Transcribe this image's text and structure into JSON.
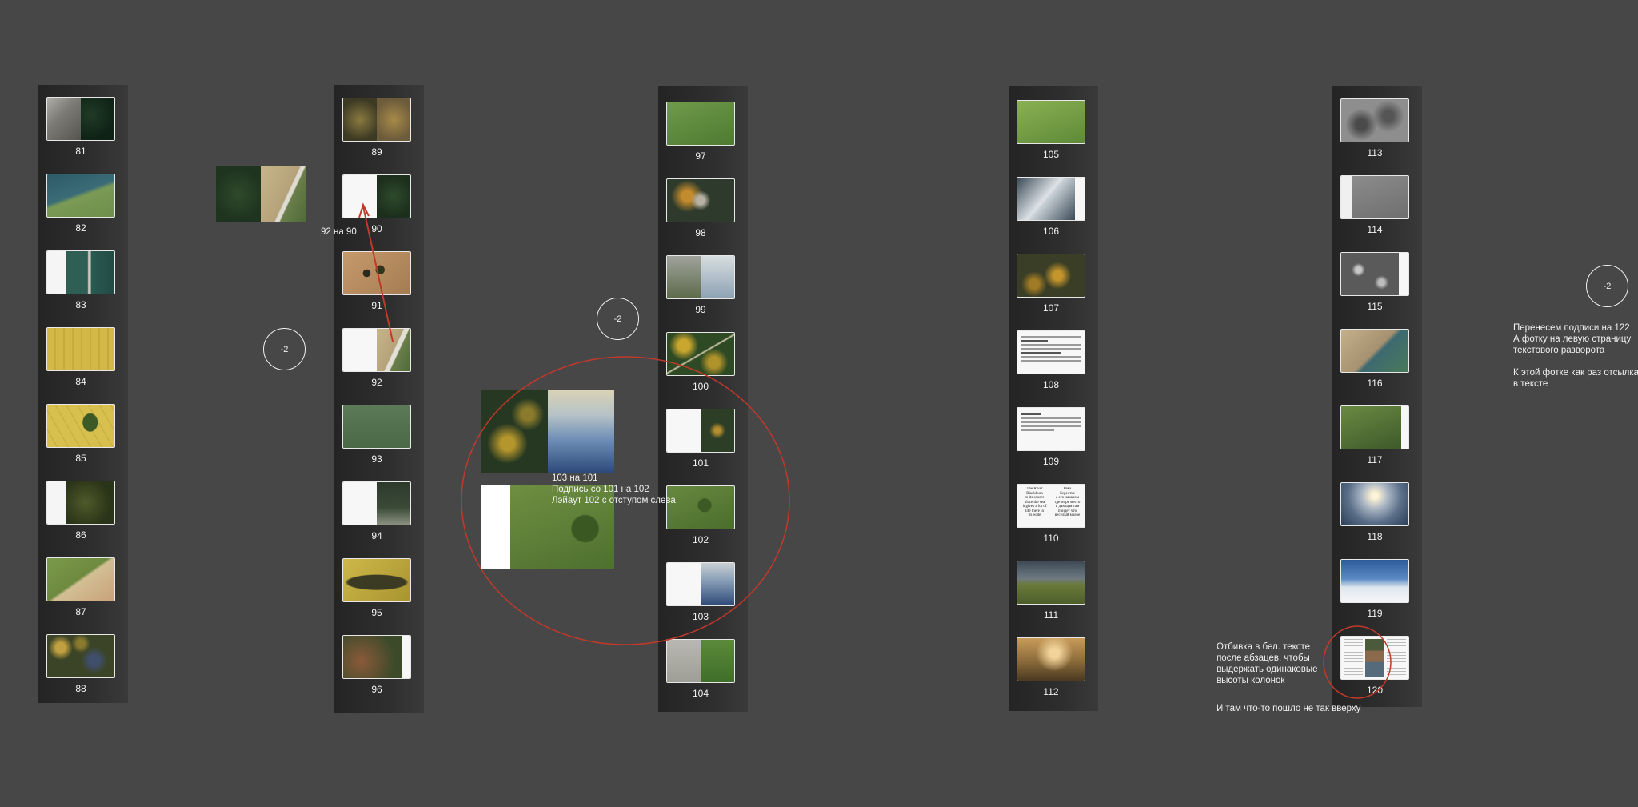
{
  "columns": [
    {
      "pages": [
        "81",
        "82",
        "83",
        "84",
        "85",
        "86",
        "87",
        "88"
      ]
    },
    {
      "pages": [
        "89",
        "90",
        "91",
        "92",
        "93",
        "94",
        "95",
        "96"
      ]
    },
    {
      "pages": [
        "97",
        "98",
        "99",
        "100",
        "101",
        "102",
        "103",
        "104"
      ]
    },
    {
      "pages": [
        "105",
        "106",
        "107",
        "108",
        "109",
        "110",
        "111",
        "112"
      ]
    },
    {
      "pages": [
        "113",
        "114",
        "115",
        "116",
        "117",
        "118",
        "119",
        "120"
      ]
    }
  ],
  "badges": {
    "b1": "-2",
    "b2": "-2",
    "b3": "-2"
  },
  "notes": {
    "n92on90": "92 на 90",
    "n103": "103 на 101\nПодпись со 101 на 102\nЛэйаут 102 с отступом слева",
    "n_right": "Перенесем подписи на 122\nА фотку на левую страницу\nтекстового разворота\n\nК этой фотке как раз отсылка\nв тексте",
    "n_bottom": "Отбивка в бел. тексте\nпосле абзацев, чтобы\nвыдержать одинаковые\nвысоты колонок",
    "n_bottom2": "И там что-то пошло не так вверху"
  },
  "thumb110_text": {
    "left": "The River\nBlackburn\nto its source\nplace the sea\nit gives a lot of\nlife there in\nits wide",
    "right": "Река\nБерестье\nс его началом\nгде море место\nи дающая там\nпридёт что\nвесёлый малое"
  },
  "colors": {
    "annotation": "#c0392b",
    "background": "#474747"
  }
}
